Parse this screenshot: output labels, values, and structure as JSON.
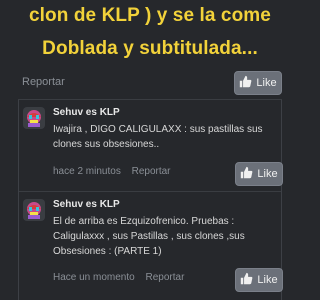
{
  "headline": {
    "line1": "clon de KLP ) y se la come",
    "line2": "Doblada y subtitulada..."
  },
  "post_actions": {
    "report_label": "Reportar",
    "like_label": "Like"
  },
  "comments": [
    {
      "author": "Sehuv es KLP",
      "text": "Iwajira , DIGO CALIGULAXX : sus pastillas sus clones sus obsesiones..",
      "time": "hace 2 minutos",
      "report_label": "Reportar",
      "like_label": "Like"
    },
    {
      "author": "Sehuv es KLP",
      "text": "El de arriba es Ezquizofrenico. Pruebas : Caligulaxxx , sus Pastillas , sus clones ,sus Obsesiones : (PARTE 1)",
      "time": "Hace un momento",
      "report_label": "Reportar",
      "like_label": "Like"
    }
  ],
  "colors": {
    "background": "#26282c",
    "headline": "#f2d23a",
    "button": "#6b7079"
  }
}
